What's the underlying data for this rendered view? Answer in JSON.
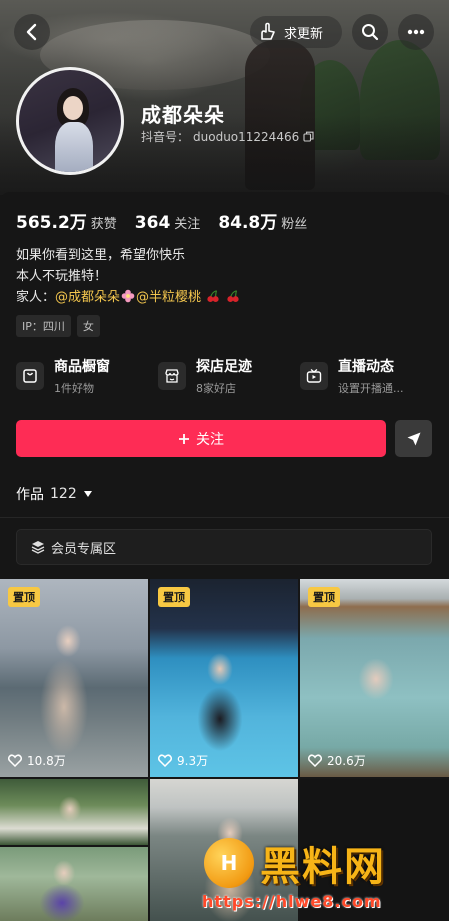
{
  "header": {
    "update_label": "求更新",
    "nickname": "成都朵朵",
    "douyin_id_label": "抖音号：",
    "douyin_id": "duoduo11224466"
  },
  "stats": {
    "likes_value": "565.2万",
    "likes_label": "获赞",
    "following_value": "364",
    "following_label": "关注",
    "followers_value": "84.8万",
    "followers_label": "粉丝"
  },
  "bio": {
    "line1": "如果你看到这里，希望你快乐",
    "line2": "本人不玩推特！",
    "family_label": "家人：",
    "mention1": "@成都朵朵",
    "mention2": "@半粒樱桃"
  },
  "tags": [
    "IP：四川",
    "女"
  ],
  "cards": [
    {
      "title": "商品橱窗",
      "sub": "1件好物",
      "icon": "shop-window-icon"
    },
    {
      "title": "探店足迹",
      "sub": "8家好店",
      "icon": "store-visit-icon"
    },
    {
      "title": "直播动态",
      "sub": "设置开播通...",
      "icon": "live-tv-icon"
    }
  ],
  "follow_label": "关注",
  "works": {
    "label": "作品",
    "count": "122"
  },
  "vip_zone_label": "会员专属区",
  "videos": [
    {
      "pinned": "置顶",
      "likes": "10.8万"
    },
    {
      "pinned": "置顶",
      "likes": "9.3万"
    },
    {
      "pinned": "置顶",
      "likes": "20.6万"
    }
  ],
  "watermark": {
    "brand": "黑料网",
    "url": "https://hlwe8.com"
  },
  "colors": {
    "accent": "#fe2c55",
    "mention": "#f3c64e",
    "pin": "#f7c843"
  }
}
